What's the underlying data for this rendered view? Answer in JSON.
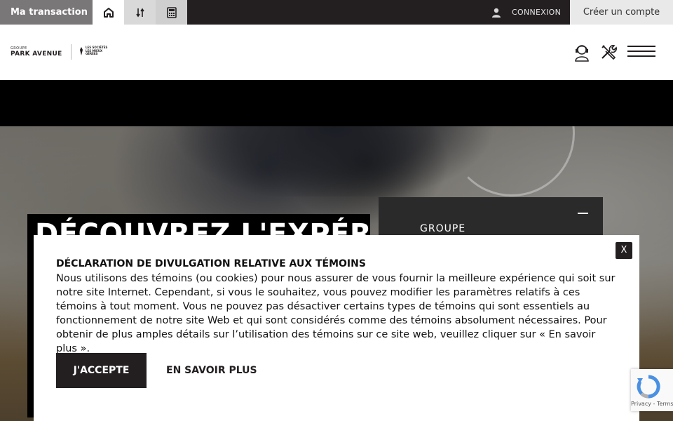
{
  "topbar": {
    "transaction_label": "Ma transaction",
    "tabs": [
      {
        "icon": "house-icon"
      },
      {
        "icon": "dollar-swap-icon"
      },
      {
        "icon": "calculator-icon"
      }
    ],
    "login_label": "CONNEXION",
    "create_account_label": "Créer un compte"
  },
  "header": {
    "logo": {
      "small": "GROUPE",
      "big": "PARK AVENUE"
    },
    "badge_text": "LES SOCIÉTÉS LES MIEUX GÉRÉES",
    "icons": [
      "agent-icon",
      "tools-icon",
      "menu-icon"
    ]
  },
  "hero": {
    "title": "DÉCOUVREZ L'EXPÉRIENCE",
    "group_label": "GROUPE"
  },
  "cookie": {
    "close_label": "X",
    "title": "DÉCLARATION DE DIVULGATION RELATIVE AUX TÉMOINS",
    "body": "Nous utilisons des témoins (ou cookies) pour nous assurer de vous fournir la meilleure expérience qui soit sur notre site Internet. Cependant, si vous le souhaitez, vous pouvez modifier les paramètres relatifs à ces témoins à tout moment. Vous ne pouvez pas désactiver certains types de témoins qui sont essentiels au fonctionnement de notre site Web et qui sont considérés comme des témoins absolument nécessaires. Pour obtenir de plus amples détails sur l’utilisation des témoins sur ce site web, veuillez cliquer sur « En savoir plus ».",
    "accept_label": "J'ACCEPTE",
    "more_label": "EN SAVOIR PLUS"
  },
  "recaptcha": {
    "text": "Privacy - Terms"
  },
  "colors": {
    "dark": "#231f20",
    "tab_grey": "#7a7778",
    "accent_light": "#e9e9e9"
  }
}
